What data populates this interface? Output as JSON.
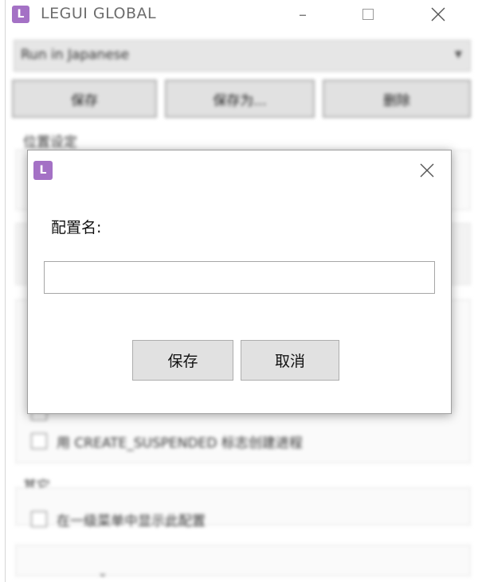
{
  "window": {
    "title": "LEGUI GLOBAL",
    "logo_letter": "L",
    "accent_color": "#a471c5"
  },
  "background": {
    "profile_select_value": "Run in Japanese",
    "buttons": [
      "保存",
      "保存为...",
      "删除"
    ],
    "section_location": "位置设定",
    "options": [
      "",
      "用 CREATE_SUSPENDED 标志创建进程"
    ],
    "section_misc": "其它",
    "misc_options": [
      "在一级菜单中显示此配置"
    ]
  },
  "dialog": {
    "logo_letter": "L",
    "label": "配置名:",
    "input_value": "",
    "ok_label": "保存",
    "cancel_label": "取消"
  }
}
